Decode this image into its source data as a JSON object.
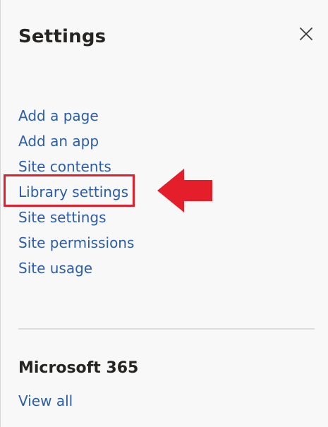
{
  "settings": {
    "title": "Settings",
    "close_icon": "close-icon",
    "links": [
      {
        "label": "Add a page"
      },
      {
        "label": "Add an app"
      },
      {
        "label": "Site contents"
      },
      {
        "label": "Library settings"
      },
      {
        "label": "Site settings"
      },
      {
        "label": "Site permissions"
      },
      {
        "label": "Site usage"
      }
    ]
  },
  "microsoft365": {
    "title": "Microsoft 365",
    "view_all_label": "View all"
  },
  "annotation": {
    "highlight_color": "#e41f2b",
    "arrow_color": "#e41f2b",
    "highlighted_item": "Library settings"
  },
  "colors": {
    "link": "#2b5da8",
    "heading": "#252423",
    "background": "#f8f8f8",
    "divider": "#dddddd"
  }
}
